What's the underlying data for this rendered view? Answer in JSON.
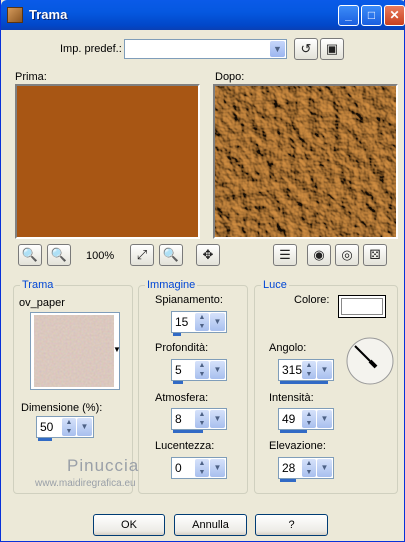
{
  "window": {
    "title": "Trama",
    "minimize": "_",
    "maximize": "□",
    "close": "✕"
  },
  "presets": {
    "label": "Imp. predef.:",
    "value": ""
  },
  "preview": {
    "before_label": "Prima:",
    "after_label": "Dopo:",
    "zoom": "100%"
  },
  "trama": {
    "legend": "Trama",
    "texture_name": "ov_paper",
    "size_label": "Dimensione (%):",
    "size_value": "50"
  },
  "immagine": {
    "legend": "Immagine",
    "smoothness_label": "Spianamento:",
    "smoothness_value": "15",
    "depth_label": "Profondità:",
    "depth_value": "5",
    "ambience_label": "Atmosfera:",
    "ambience_value": "8",
    "shininess_label": "Lucentezza:",
    "shininess_value": "0"
  },
  "luce": {
    "legend": "Luce",
    "color_label": "Colore:",
    "color": "#ffffff",
    "angle_label": "Angolo:",
    "angle_value": "315",
    "intensity_label": "Intensità:",
    "intensity_value": "49",
    "elevation_label": "Elevazione:",
    "elevation_value": "28"
  },
  "watermark": {
    "name": "Pinuccia",
    "site": "www.maidiregrafica.eu"
  },
  "buttons": {
    "ok": "OK",
    "cancel": "Annulla",
    "help": "?"
  },
  "colors": {
    "before_fill": "#a85614",
    "texture_base": "#c98a3a",
    "titlebar": "#0558e0"
  }
}
